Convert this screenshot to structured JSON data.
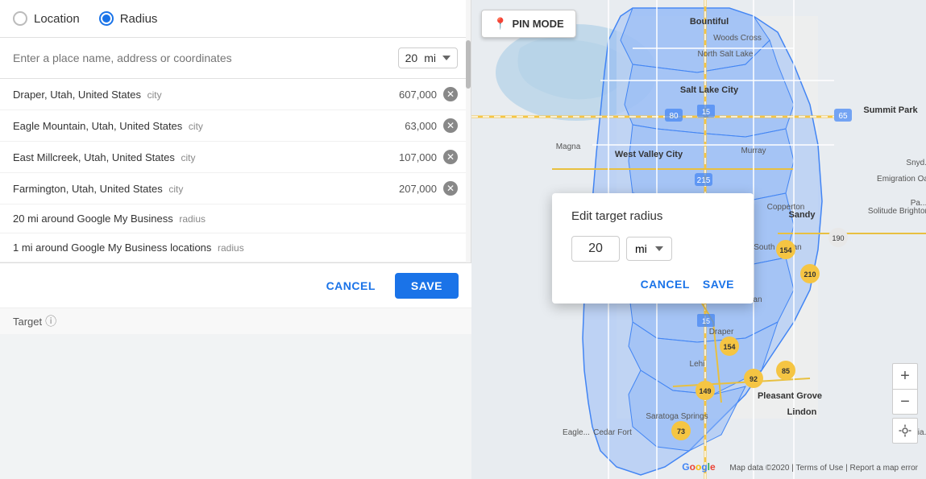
{
  "radio": {
    "location_label": "Location",
    "radius_label": "Radius",
    "location_selected": false,
    "radius_selected": true
  },
  "search": {
    "placeholder": "Enter a place name, address or coordinates",
    "distance_value": "20",
    "distance_unit": "mi"
  },
  "locations": [
    {
      "name": "Draper, Utah, United States",
      "type": "city",
      "count": "607,000"
    },
    {
      "name": "Eagle Mountain, Utah, United States",
      "type": "city",
      "count": "63,000"
    },
    {
      "name": "East Millcreek, Utah, United States",
      "type": "city",
      "count": "107,000"
    },
    {
      "name": "Farmington, Utah, United States",
      "type": "city",
      "count": "207,000"
    }
  ],
  "radius_items": [
    {
      "label": "20 mi around Google My Business",
      "type": "radius"
    },
    {
      "label": "1 mi around Google My Business locations",
      "type": "radius"
    }
  ],
  "bottom_bar": {
    "cancel_label": "CANCEL",
    "save_label": "SAVE"
  },
  "map": {
    "pin_mode_label": "PIN MODE",
    "zoom_in_label": "+",
    "zoom_out_label": "−",
    "attribution": "Map data ©2020 | Terms of Use | Report a map error",
    "google_label": "Google"
  },
  "popup": {
    "title": "Edit target radius",
    "distance_value": "20",
    "distance_unit": "mi",
    "cancel_label": "CANCEL",
    "save_label": "SAVE"
  },
  "target_label": "Target"
}
